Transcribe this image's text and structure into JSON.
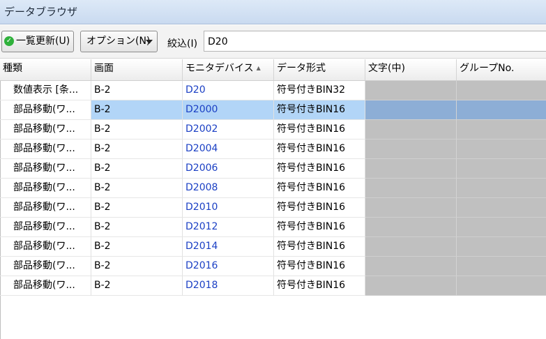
{
  "window": {
    "title": "データブラウザ"
  },
  "toolbar": {
    "refresh_label": "一覧更新(U)",
    "options_label": "オプション(N)",
    "filter_label": "絞込(I)",
    "filter_value": "D20"
  },
  "columns": [
    "種類",
    "画面",
    "モニタデバイス",
    "データ形式",
    "文字(中)",
    "グループNo."
  ],
  "rows": [
    {
      "kind": "数値表示 [条...",
      "screen": "B-2",
      "device": "D20",
      "format": "符号付きBIN32",
      "text": "",
      "group": ""
    },
    {
      "kind": "部品移動(ワ...",
      "screen": "B-2",
      "device": "D2000",
      "format": "符号付きBIN16",
      "text": "",
      "group": ""
    },
    {
      "kind": "部品移動(ワ...",
      "screen": "B-2",
      "device": "D2002",
      "format": "符号付きBIN16",
      "text": "",
      "group": ""
    },
    {
      "kind": "部品移動(ワ...",
      "screen": "B-2",
      "device": "D2004",
      "format": "符号付きBIN16",
      "text": "",
      "group": ""
    },
    {
      "kind": "部品移動(ワ...",
      "screen": "B-2",
      "device": "D2006",
      "format": "符号付きBIN16",
      "text": "",
      "group": ""
    },
    {
      "kind": "部品移動(ワ...",
      "screen": "B-2",
      "device": "D2008",
      "format": "符号付きBIN16",
      "text": "",
      "group": ""
    },
    {
      "kind": "部品移動(ワ...",
      "screen": "B-2",
      "device": "D2010",
      "format": "符号付きBIN16",
      "text": "",
      "group": ""
    },
    {
      "kind": "部品移動(ワ...",
      "screen": "B-2",
      "device": "D2012",
      "format": "符号付きBIN16",
      "text": "",
      "group": ""
    },
    {
      "kind": "部品移動(ワ...",
      "screen": "B-2",
      "device": "D2014",
      "format": "符号付きBIN16",
      "text": "",
      "group": ""
    },
    {
      "kind": "部品移動(ワ...",
      "screen": "B-2",
      "device": "D2016",
      "format": "符号付きBIN16",
      "text": "",
      "group": ""
    },
    {
      "kind": "部品移動(ワ...",
      "screen": "B-2",
      "device": "D2018",
      "format": "符号付きBIN16",
      "text": "",
      "group": ""
    }
  ],
  "selected_row": 1,
  "icons": {
    "refresh": "green-check-icon",
    "options": "dropdown-arrow-icon",
    "sort": "sort-ascending-icon"
  },
  "colors": {
    "device_text": "#1a3fc4",
    "selection": "#b2d5f7",
    "disabled_cell": "#c0c0c0"
  }
}
